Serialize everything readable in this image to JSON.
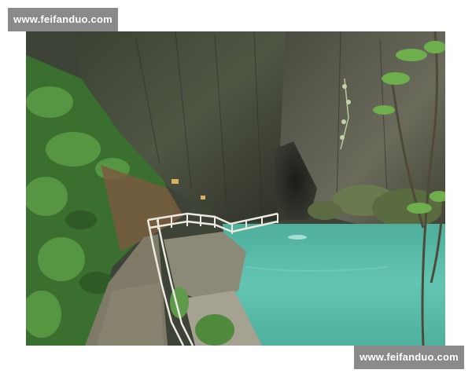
{
  "watermarks": {
    "top_left": "www.feifanduo.com",
    "bottom_right": "www.feifanduo.com"
  },
  "photo": {
    "subject": "gorge-with-river-and-walkway",
    "colors": {
      "water": "#5fc1ae",
      "cliff_dark": "#2e3328",
      "cliff_mid": "#55574a",
      "foliage": "#3f7a36",
      "path": "#7f7a68",
      "railing": "#e9e6dc"
    }
  }
}
